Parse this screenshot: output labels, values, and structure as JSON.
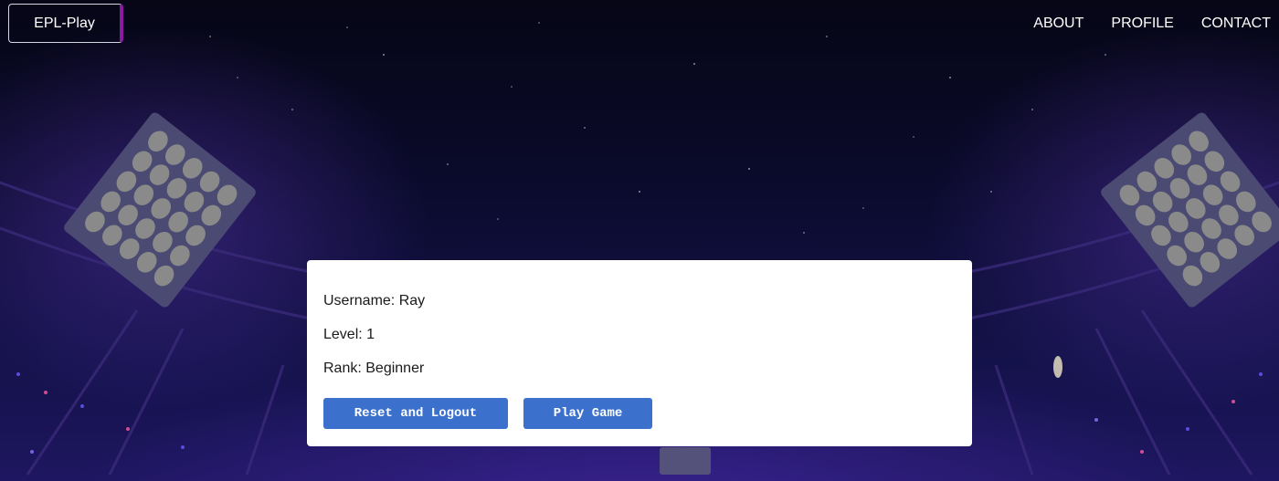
{
  "header": {
    "logo_text": "EPL-Play",
    "nav": [
      {
        "label": "ABOUT"
      },
      {
        "label": "PROFILE"
      },
      {
        "label": "CONTACT"
      }
    ]
  },
  "profile": {
    "username_line": "Username: Ray",
    "level_line": "Level: 1",
    "rank_line": "Rank: Beginner",
    "reset_button": "Reset and Logout",
    "play_button": "Play Game"
  },
  "colors": {
    "accent_button": "#3b71cc",
    "logo_border_accent": "#8a1aa0",
    "background": "#06061a"
  }
}
